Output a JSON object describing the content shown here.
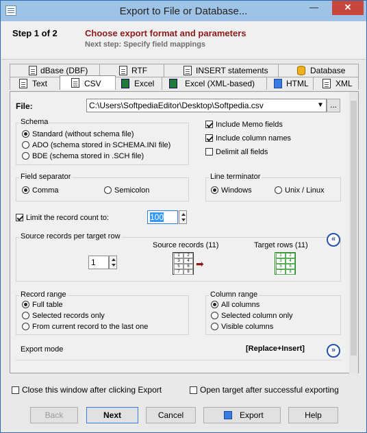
{
  "window": {
    "title": "Export to File or Database..."
  },
  "header": {
    "step": "Step 1 of 2",
    "heading": "Choose export format and parameters",
    "next_step": "Next step: Specify field mappings"
  },
  "tabs_top": [
    "dBase (DBF)",
    "RTF",
    "INSERT statements",
    "Database"
  ],
  "tabs_bottom": [
    "Text",
    "CSV",
    "Excel",
    "Excel (XML-based)",
    "HTML",
    "XML"
  ],
  "active_tab": "CSV",
  "file": {
    "label": "File:",
    "value": "C:\\Users\\SoftpediaEditor\\Desktop\\Softpedia.csv",
    "browse": "..."
  },
  "schema": {
    "title": "Schema",
    "options": [
      "Standard (without schema file)",
      "ADO (schema stored in SCHEMA.INI file)",
      "BDE (schema stored in .SCH file)"
    ],
    "selected": 0
  },
  "options_right": [
    {
      "label": "Include Memo fields",
      "checked": true
    },
    {
      "label": "Include column names",
      "checked": true
    },
    {
      "label": "Delimit all fields",
      "checked": false
    }
  ],
  "field_separator": {
    "title": "Field separator",
    "options": [
      "Comma",
      "Semicolon"
    ],
    "selected": 0
  },
  "line_terminator": {
    "title": "Line terminator",
    "options": [
      "Windows",
      "Unix / Linux"
    ],
    "selected": 0
  },
  "limit": {
    "label": "Limit the record count to:",
    "checked": true,
    "value": "100"
  },
  "source_per_target": {
    "title": "Source records per target row",
    "value": "1",
    "source_label": "Source records (11)",
    "target_label": "Target rows (11)",
    "grid_cells": [
      "1",
      "2",
      "3",
      "4",
      "5",
      "6",
      "7",
      "8"
    ]
  },
  "record_range": {
    "title": "Record range",
    "options": [
      "Full table",
      "Selected records only",
      "From current record to the last one"
    ],
    "selected": 0
  },
  "column_range": {
    "title": "Column range",
    "options": [
      "All columns",
      "Selected column only",
      "Visible columns"
    ],
    "selected": 0
  },
  "export_mode": {
    "label": "Export mode",
    "value": "[Replace+Insert]"
  },
  "bottom_checks": [
    {
      "label": "Close this window after clicking Export",
      "checked": false
    },
    {
      "label": "Open target after successful exporting",
      "checked": false
    }
  ],
  "buttons": {
    "back": "Back",
    "next": "Next",
    "cancel": "Cancel",
    "export": "Export",
    "help": "Help"
  },
  "colors": {
    "titlebar": "#9fc3e6",
    "close": "#c7463d",
    "heading": "#8b1a1a",
    "accent": "#2650a8"
  }
}
